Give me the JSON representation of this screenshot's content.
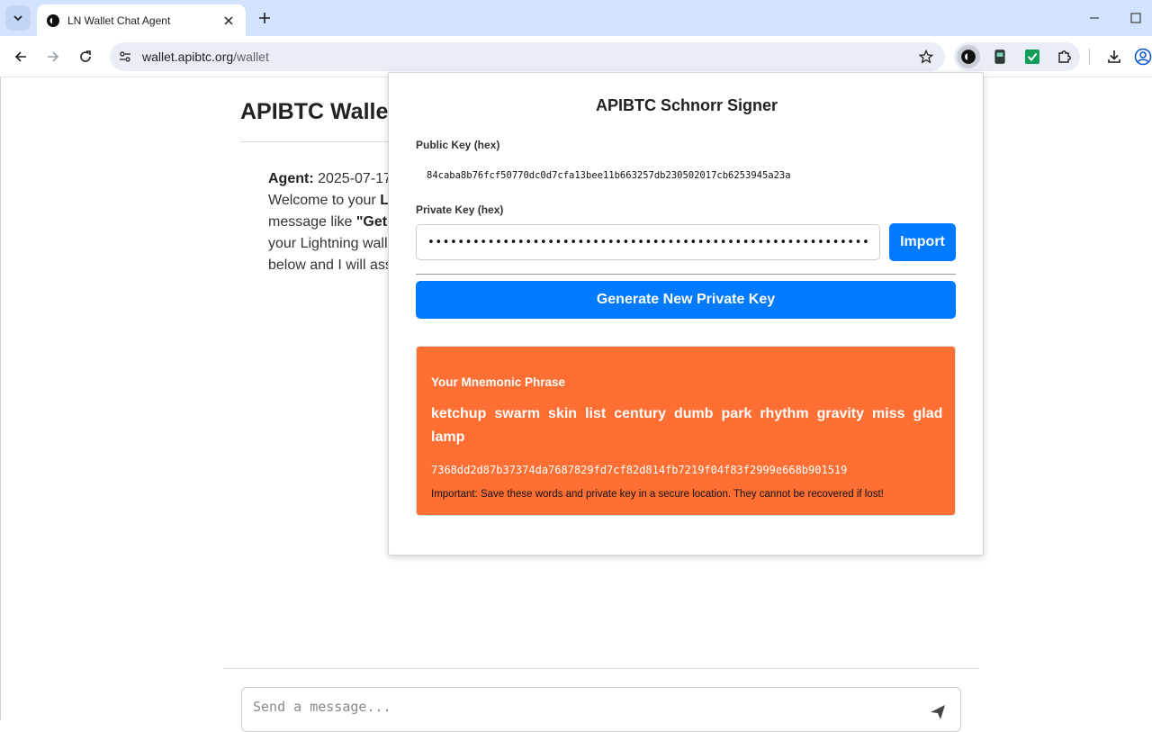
{
  "browser": {
    "tab_title": "LN Wallet Chat Agent",
    "url_host": "wallet.apibtc.org",
    "url_path": "/wallet"
  },
  "page": {
    "title": "APIBTC Wallet",
    "agent_label": "Agent:",
    "agent_timestamp": "2025-07-17",
    "line1_prefix": "Welcome to your ",
    "line1_bold": "L",
    "line2_prefix": "message like ",
    "line2_bold": "\"Get",
    "line3": "your Lightning wall",
    "line4": "below and I will ass",
    "message_placeholder": "Send a message..."
  },
  "popup": {
    "title": "APIBTC Schnorr Signer",
    "public_key_label": "Public Key (hex)",
    "public_key_value": "84caba8b76fcf50770dc0d7cfa13bee11b663257db230502017cb6253945a23a",
    "private_key_label": "Private Key (hex)",
    "private_key_masked": "••••••••••••••••••••••••••••••••••••••••••••••••••••••••••••••••",
    "import_label": "Import",
    "generate_label": "Generate New Private Key",
    "mnemonic": {
      "heading": "Your Mnemonic Phrase",
      "words": [
        "ketchup",
        "swarm",
        "skin",
        "list",
        "century",
        "dumb",
        "park",
        "rhythm",
        "gravity",
        "miss",
        "glad",
        "lamp"
      ],
      "hex": "7368dd2d87b37374da7687829fd7cf82d814fb7219f04f83f2999e668b901519",
      "warning": "Important: Save these words and private key in a secure location. They cannot be recovered if lost!"
    },
    "colors": {
      "primary_button": "#007bff",
      "mnemonic_card": "#ff6f33"
    }
  }
}
